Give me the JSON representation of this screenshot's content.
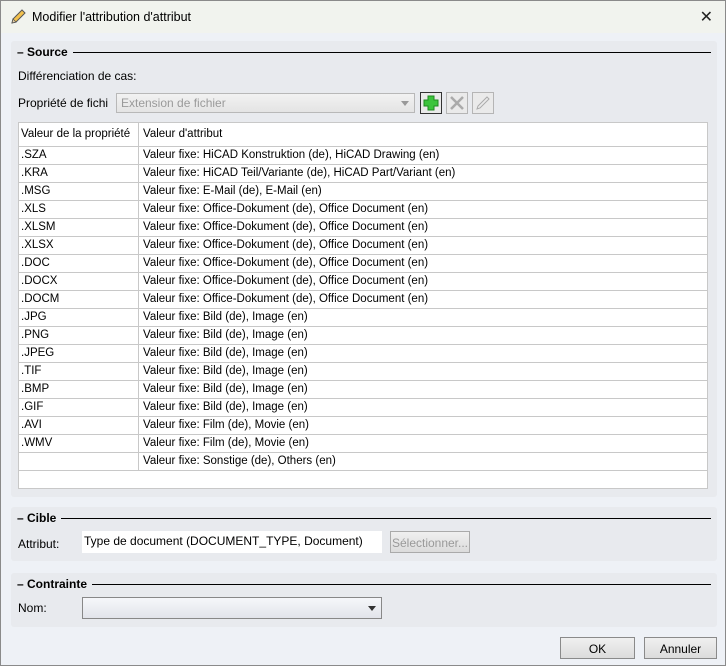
{
  "title": "Modifier l'attribution d'attribut",
  "source": {
    "heading": "Source",
    "case_label": "Différenciation de cas:",
    "property_label": "Propriété de fichi",
    "property_value": "Extension de fichier",
    "table": {
      "headers": [
        "Valeur de la propriété",
        "Valeur d'attribut"
      ],
      "rows": [
        [
          ".SZA",
          "Valeur fixe: HiCAD Konstruktion (de), HiCAD Drawing (en)"
        ],
        [
          ".KRA",
          "Valeur fixe: HiCAD Teil/Variante (de), HiCAD Part/Variant (en)"
        ],
        [
          ".MSG",
          "Valeur fixe: E-Mail (de), E-Mail (en)"
        ],
        [
          ".XLS",
          "Valeur fixe: Office-Dokument (de), Office Document (en)"
        ],
        [
          ".XLSM",
          "Valeur fixe: Office-Dokument (de), Office Document (en)"
        ],
        [
          ".XLSX",
          "Valeur fixe: Office-Dokument (de), Office Document (en)"
        ],
        [
          ".DOC",
          "Valeur fixe: Office-Dokument (de), Office Document (en)"
        ],
        [
          ".DOCX",
          "Valeur fixe: Office-Dokument (de), Office Document (en)"
        ],
        [
          ".DOCM",
          "Valeur fixe: Office-Dokument (de), Office Document (en)"
        ],
        [
          ".JPG",
          "Valeur fixe: Bild (de), Image (en)"
        ],
        [
          ".PNG",
          "Valeur fixe: Bild (de), Image (en)"
        ],
        [
          ".JPEG",
          "Valeur fixe: Bild (de), Image (en)"
        ],
        [
          ".TIF",
          "Valeur fixe: Bild (de), Image (en)"
        ],
        [
          ".BMP",
          "Valeur fixe: Bild (de), Image (en)"
        ],
        [
          ".GIF",
          "Valeur fixe: Bild (de), Image (en)"
        ],
        [
          ".AVI",
          "Valeur fixe: Film (de), Movie (en)"
        ],
        [
          ".WMV",
          "Valeur fixe: Film (de), Movie (en)"
        ],
        [
          "",
          "Valeur fixe: Sonstige (de), Others (en)"
        ]
      ]
    }
  },
  "target": {
    "heading": "Cible",
    "attr_label": "Attribut:",
    "attr_value": "Type de document (DOCUMENT_TYPE, Document)",
    "select_label": "Sélectionner..."
  },
  "constraint": {
    "heading": "Contrainte",
    "name_label": "Nom:",
    "name_value": ""
  },
  "buttons": {
    "ok": "OK",
    "cancel": "Annuler"
  }
}
